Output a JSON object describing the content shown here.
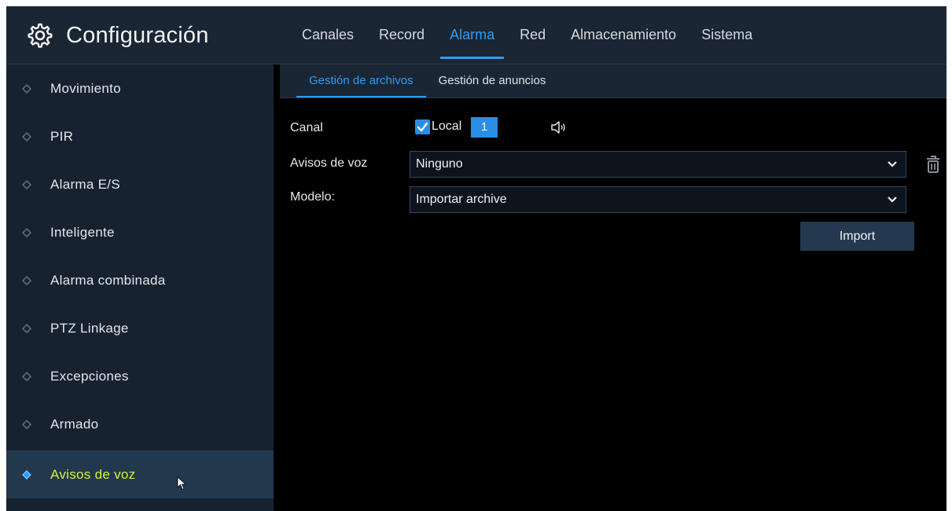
{
  "header": {
    "title": "Configuración",
    "icon": "gear-icon",
    "tabs": [
      {
        "label": "Canales",
        "active": false
      },
      {
        "label": "Record",
        "active": false
      },
      {
        "label": "Alarma",
        "active": true
      },
      {
        "label": "Red",
        "active": false
      },
      {
        "label": "Almacenamiento",
        "active": false
      },
      {
        "label": "Sistema",
        "active": false
      }
    ]
  },
  "sidebar": {
    "items": [
      {
        "label": "Movimiento",
        "active": false
      },
      {
        "label": "PIR",
        "active": false
      },
      {
        "label": "Alarma E/S",
        "active": false
      },
      {
        "label": "Inteligente",
        "active": false
      },
      {
        "label": "Alarma combinada",
        "active": false
      },
      {
        "label": "PTZ Linkage",
        "active": false
      },
      {
        "label": "Excepciones",
        "active": false
      },
      {
        "label": "Armado",
        "active": false
      },
      {
        "label": "Avisos de voz",
        "active": true
      }
    ]
  },
  "subtabs": [
    {
      "label": "Gestión de archivos",
      "active": true
    },
    {
      "label": "Gestión de anuncios",
      "active": false
    }
  ],
  "form": {
    "canal_label": "Canal",
    "local_checked": true,
    "local_label": "Local",
    "channel_number": "1",
    "voice_label": "Avisos de voz",
    "voice_value": "Ninguno",
    "model_label": "Modelo:",
    "model_value": "Importar archive",
    "import_button": "Import"
  },
  "colors": {
    "accent": "#2e9cf3",
    "active_sidebar_text": "#d8ef3c",
    "header_bg": "#1a2634",
    "sidebar_bg": "#172230"
  }
}
